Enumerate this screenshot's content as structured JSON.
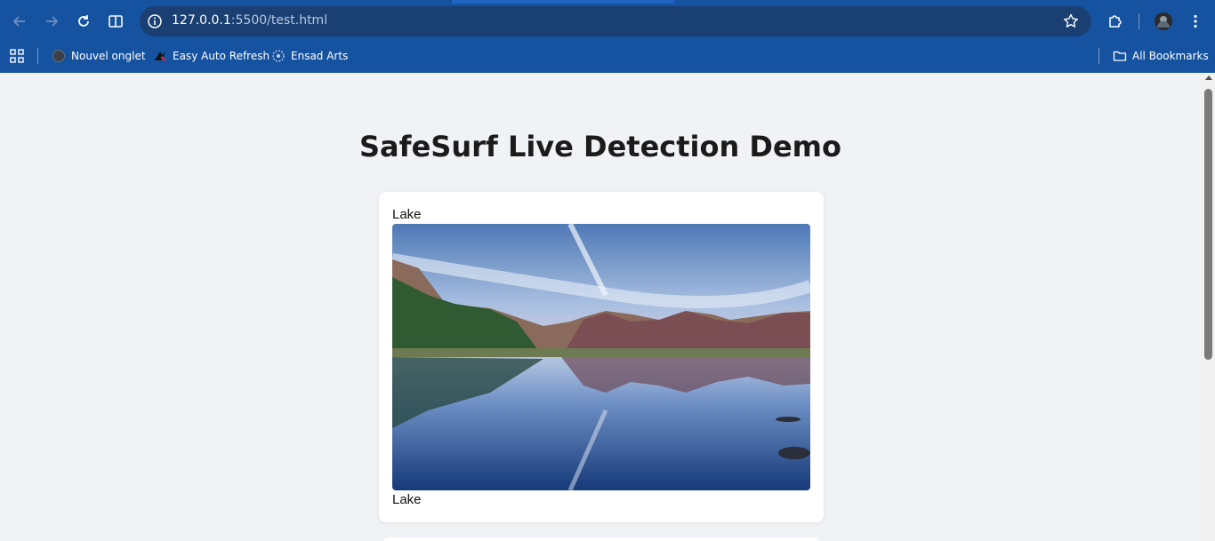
{
  "browser": {
    "url_host": "127.0.0.1",
    "url_rest": ":5500/test.html",
    "bookmarks": [
      {
        "label": "Nouvel onglet",
        "icon": "globe-icon"
      },
      {
        "label": "Easy Auto Refresh",
        "icon": "easy-auto-refresh-icon"
      },
      {
        "label": "Ensad Arts",
        "icon": "ensad-arts-icon"
      }
    ],
    "all_bookmarks": "All Bookmarks"
  },
  "page": {
    "title": "SafeSurf Live Detection Demo",
    "cards": [
      {
        "label_top": "Lake",
        "label_bottom": "Lake",
        "image": "mountain-lake-photo"
      }
    ]
  },
  "colors": {
    "chrome": "#1552a0",
    "omnibox": "#1a3f72",
    "page_bg": "#f0f2f5"
  }
}
